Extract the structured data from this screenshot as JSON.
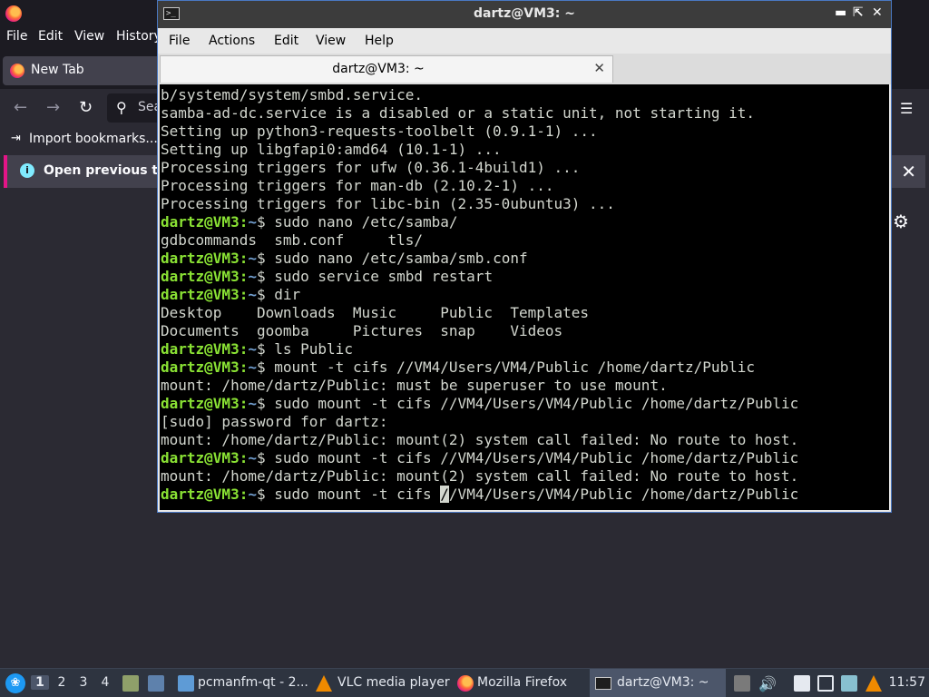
{
  "firefox": {
    "menus": [
      "File",
      "Edit",
      "View",
      "History"
    ],
    "tab_title": "New Tab",
    "search_placeholder": "Sea",
    "import_bookmarks": "Import bookmarks...",
    "notice_text": "Open previous ta",
    "nav_icons": [
      "back-arrow-icon",
      "forward-arrow-icon",
      "reload-icon",
      "search-icon",
      "menu-icon",
      "close-icon",
      "gear-icon"
    ],
    "accent": "#e31587"
  },
  "terminal": {
    "title": "dartz@VM3: ~",
    "menus": [
      "File",
      "Actions",
      "Edit",
      "View",
      "Help"
    ],
    "tab_label": "dartz@VM3: ~",
    "prompt_user": "dartz@VM3",
    "prompt_path": "~",
    "lines": [
      {
        "t": "o",
        "text": "b/systemd/system/smbd.service."
      },
      {
        "t": "o",
        "text": "samba-ad-dc.service is a disabled or a static unit, not starting it."
      },
      {
        "t": "o",
        "text": "Setting up python3-requests-toolbelt (0.9.1-1) ..."
      },
      {
        "t": "o",
        "text": "Setting up libgfapi0:amd64 (10.1-1) ..."
      },
      {
        "t": "o",
        "text": "Processing triggers for ufw (0.36.1-4build1) ..."
      },
      {
        "t": "o",
        "text": "Processing triggers for man-db (2.10.2-1) ..."
      },
      {
        "t": "o",
        "text": "Processing triggers for libc-bin (2.35-0ubuntu3) ..."
      },
      {
        "t": "p",
        "text": "$ sudo nano /etc/samba/"
      },
      {
        "t": "o",
        "text": "gdbcommands  smb.conf     tls/"
      },
      {
        "t": "p",
        "text": "$ sudo nano /etc/samba/smb.conf"
      },
      {
        "t": "p",
        "text": "$ sudo service smbd restart"
      },
      {
        "t": "p",
        "text": "$ dir"
      },
      {
        "t": "o",
        "text": "Desktop    Downloads  Music     Public  Templates"
      },
      {
        "t": "o",
        "text": "Documents  goomba     Pictures  snap    Videos"
      },
      {
        "t": "p",
        "text": "$ ls Public"
      },
      {
        "t": "p",
        "text": "$ mount -t cifs //VM4/Users/VM4/Public /home/dartz/Public"
      },
      {
        "t": "o",
        "text": "mount: /home/dartz/Public: must be superuser to use mount."
      },
      {
        "t": "p",
        "text": "$ sudo mount -t cifs //VM4/Users/VM4/Public /home/dartz/Public"
      },
      {
        "t": "o",
        "text": "[sudo] password for dartz:"
      },
      {
        "t": "o",
        "text": "mount: /home/dartz/Public: mount(2) system call failed: No route to host."
      },
      {
        "t": "p",
        "text": "$ sudo mount -t cifs //VM4/Users/VM4/Public /home/dartz/Public"
      },
      {
        "t": "o",
        "text": "mount: /home/dartz/Public: mount(2) system call failed: No route to host."
      },
      {
        "t": "c",
        "before": "$ sudo mount -t cifs ",
        "cursor": "/",
        "after": "/VM4/Users/VM4/Public /home/dartz/Public"
      }
    ],
    "colors": {
      "prompt_user": "#8ae234",
      "prompt_path": "#729fcf",
      "text": "#d3d7cf",
      "background": "#000000"
    }
  },
  "taskbar": {
    "workspaces": [
      "1",
      "2",
      "3",
      "4"
    ],
    "tasks": [
      {
        "label": "pcmanfm-qt - 2...",
        "icon": "folder-icon"
      },
      {
        "label": "VLC media player",
        "icon": "vlc-cone-icon"
      },
      {
        "label": "Mozilla Firefox",
        "icon": "firefox-icon"
      },
      {
        "label": "dartz@VM3: ~",
        "icon": "terminal-icon"
      }
    ],
    "clock": "11:57"
  }
}
